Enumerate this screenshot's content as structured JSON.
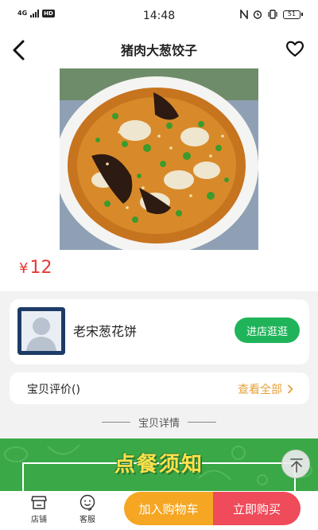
{
  "status_bar": {
    "network": "4G",
    "hd": "HD",
    "time": "14:48",
    "battery": "51"
  },
  "header": {
    "title": "猪肉大葱饺子"
  },
  "product": {
    "currency": "¥",
    "price": "12"
  },
  "shop": {
    "name": "老宋葱花饼",
    "visit_label": "进店逛逛"
  },
  "reviews": {
    "title": "宝贝评价()",
    "view_all_label": "查看全部"
  },
  "details": {
    "section_label": "宝贝详情"
  },
  "banner": {
    "text": "点餐须知"
  },
  "bottom_bar": {
    "shop_label": "店铺",
    "service_label": "客服",
    "add_to_cart_label": "加入购物车",
    "buy_now_label": "立即购买"
  },
  "colors": {
    "price": "#e53935",
    "visit_button": "#20b45a",
    "view_all": "#e6a23c",
    "add_to_cart": "#f5a623",
    "buy_now": "#ef4b5a",
    "banner": "#3aa847"
  },
  "icons": {
    "back": "back-arrow-icon",
    "favorite": "heart-outline-icon",
    "shop": "store-icon",
    "service": "customer-service-icon",
    "to_top": "arrow-up-icon",
    "chevron": "chevron-right-icon"
  }
}
